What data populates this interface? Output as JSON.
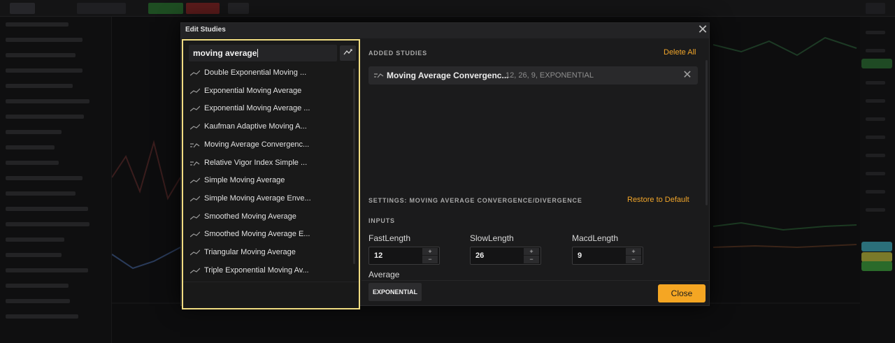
{
  "dialog": {
    "title": "Edit Studies",
    "close_icon": "close-icon"
  },
  "search": {
    "value": "moving average",
    "filter_icon": "filter-icon"
  },
  "study_list": [
    {
      "label": "Double Exponential Moving ...",
      "icon": "trend-line-icon"
    },
    {
      "label": "Exponential Moving Average",
      "icon": "trend-line-icon"
    },
    {
      "label": "Exponential Moving Average ...",
      "icon": "trend-line-icon"
    },
    {
      "label": "Kaufman Adaptive Moving A...",
      "icon": "trend-line-icon"
    },
    {
      "label": "Moving Average Convergenc...",
      "icon": "oscillator-icon"
    },
    {
      "label": "Relative Vigor Index Simple ...",
      "icon": "oscillator-icon"
    },
    {
      "label": "Simple Moving Average",
      "icon": "trend-line-icon"
    },
    {
      "label": "Simple Moving Average Enve...",
      "icon": "trend-line-icon"
    },
    {
      "label": "Smoothed Moving Average",
      "icon": "trend-line-icon"
    },
    {
      "label": "Smoothed Moving Average E...",
      "icon": "trend-line-icon"
    },
    {
      "label": "Triangular Moving Average",
      "icon": "trend-line-icon"
    },
    {
      "label": "Triple Exponential Moving Av...",
      "icon": "trend-line-icon"
    }
  ],
  "added_studies": {
    "heading": "ADDED STUDIES",
    "delete_all": "Delete All",
    "items": [
      {
        "name": "Moving Average Convergenc...",
        "params": "12, 26, 9, EXPONENTIAL",
        "icon": "oscillator-icon"
      }
    ]
  },
  "settings": {
    "heading": "SETTINGS: MOVING AVERAGE CONVERGENCE/DIVERGENCE",
    "restore_default": "Restore to Default",
    "inputs_heading": "INPUTS",
    "fields": [
      {
        "label": "FastLength",
        "value": "12"
      },
      {
        "label": "SlowLength",
        "value": "26"
      },
      {
        "label": "MacdLength",
        "value": "9"
      }
    ],
    "average_label": "Average",
    "average_value": "EXPONENTIAL"
  },
  "footer": {
    "close_label": "Close"
  },
  "colors": {
    "accent": "#f5a623",
    "highlight_border": "#f0dc82"
  }
}
